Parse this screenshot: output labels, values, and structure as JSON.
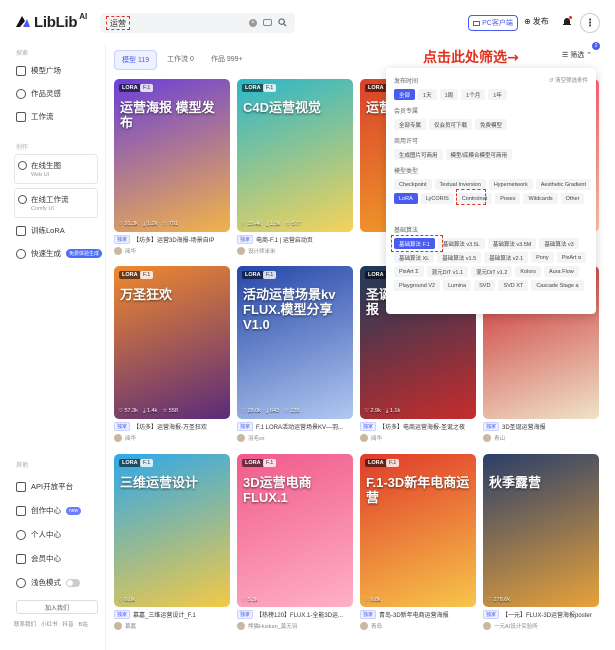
{
  "header": {
    "logo_text": "LibLib",
    "logo_sup": "AI",
    "search_value": "运营",
    "pc_client": "PC客户端",
    "publish": "发布"
  },
  "sidebar": {
    "section_explore": "探索",
    "explore_items": [
      {
        "label": "模型广场",
        "icon": "home-icon"
      },
      {
        "label": "作品灵感",
        "icon": "image-icon"
      },
      {
        "label": "工作流",
        "icon": "flow-icon"
      }
    ],
    "section_create": "创作",
    "create_boxes": [
      {
        "label": "在线生图",
        "sub": "Web UI"
      },
      {
        "label": "在线工作流",
        "sub": "Comfy UI"
      }
    ],
    "train": "训练LoRA",
    "quick": "快速生成",
    "quick_badge": "免费体验生成",
    "section_other": "其他",
    "other_items": [
      {
        "label": "API开放平台"
      },
      {
        "label": "创作中心",
        "badge": "new"
      },
      {
        "label": "个人中心"
      },
      {
        "label": "会员中心"
      },
      {
        "label": "浅色模式"
      }
    ],
    "join": "加入我们",
    "footer": [
      "联系我们",
      "小红书",
      "抖音",
      "B站"
    ]
  },
  "main": {
    "tabs": [
      {
        "label": "模型 119",
        "active": true
      },
      {
        "label": "工作流 0",
        "active": false
      },
      {
        "label": "作品 999+",
        "active": false
      }
    ],
    "annotation": "点击此处筛选→",
    "filter": "筛选",
    "filter_count": "2"
  },
  "filter_panel": {
    "reset": "清空筛选条件",
    "time_label": "发布时间",
    "time": [
      {
        "label": "全部",
        "on": true
      },
      {
        "label": "1天"
      },
      {
        "label": "1周"
      },
      {
        "label": "1个月"
      },
      {
        "label": "1年"
      }
    ],
    "member_label": "会员专属",
    "member": [
      {
        "label": "全部专属"
      },
      {
        "label": "仅会员可下载"
      },
      {
        "label": "免费模型"
      }
    ],
    "license_label": "商用许可",
    "license": [
      {
        "label": "生成图片可商用"
      },
      {
        "label": "模型/底模合模型可商用"
      }
    ],
    "type_label": "模型类型",
    "types": [
      {
        "label": "Checkpoint"
      },
      {
        "label": "Textual Inversion"
      },
      {
        "label": "Hypernetwork"
      },
      {
        "label": "Aesthetic Gradient"
      },
      {
        "label": "LoRA",
        "on": true
      },
      {
        "label": "LyCORIS"
      },
      {
        "label": "Controlnet"
      },
      {
        "label": "Poses"
      },
      {
        "label": "Wildcards"
      },
      {
        "label": "Other"
      }
    ],
    "base_label": "基础算法",
    "bases": [
      {
        "label": "基础算法 F.1",
        "on": true
      },
      {
        "label": "基础算法 v3.5L"
      },
      {
        "label": "基础算法 v3.5M"
      },
      {
        "label": "基础算法 v3"
      },
      {
        "label": "基础算法 XL"
      },
      {
        "label": "基础算法 v1.5"
      },
      {
        "label": "基础算法 v2.1"
      },
      {
        "label": "Pony"
      },
      {
        "label": "PixArt α"
      },
      {
        "label": "PixArt Σ"
      },
      {
        "label": "混元DiT v1.1"
      },
      {
        "label": "混元DiT v1.2"
      },
      {
        "label": "Kolors"
      },
      {
        "label": "Aura Flow"
      },
      {
        "label": "Playground V2"
      },
      {
        "label": "Lumina"
      },
      {
        "label": "SVD"
      },
      {
        "label": "SVD XT"
      },
      {
        "label": "Cascade Stage a"
      }
    ]
  },
  "cards": [
    {
      "tag": "LORA",
      "tag2": "F.1",
      "big": "运营海报 模型发布",
      "likes": "91.3k",
      "downloads": "1.2k",
      "stars": "791",
      "title": "【坊多】运营3D海报-场景自IP",
      "author": "阅华",
      "c1": "#6a3fd8",
      "c2": "#f2b34a"
    },
    {
      "tag": "LORA",
      "tag2": "F.1",
      "big": "C4D运营视觉",
      "likes": "19.4k",
      "downloads": "1.3k",
      "stars": "577",
      "title": "电商-F.1 | 运营启动页",
      "author": "设计师米米",
      "c1": "#2bb6c9",
      "c2": "#f5d35a"
    },
    {
      "tag": "LORA",
      "tag2": "F.1",
      "big": "运营 海报",
      "likes": "",
      "downloads": "",
      "stars": "",
      "title": "",
      "author": "",
      "c1": "#d8402b",
      "c2": "#f4a62a"
    },
    {
      "tag": "",
      "tag2": "",
      "big": "",
      "likes": "",
      "downloads": "",
      "stars": "",
      "title": "",
      "author": "",
      "c1": "#fd4c6a",
      "c2": "#ffc9a8"
    },
    {
      "tag": "LORA",
      "tag2": "F.1",
      "big": "万圣狂欢",
      "likes": "57.3k",
      "downloads": "1.4k",
      "stars": "558",
      "title": "【坊多】运营海报-万圣狂欢",
      "author": "阅华",
      "c1": "#f08a2e",
      "c2": "#5a2b7a"
    },
    {
      "tag": "LORA",
      "tag2": "F.1",
      "big": "活动运营场景kv FLUX.模型分享 V1.0",
      "likes": "28.0k",
      "downloads": "643",
      "stars": "235",
      "title": "F.1 LORA活动运营场景KV—羽...",
      "author": "羽毛xx",
      "c1": "#2646a8",
      "c2": "#b1c8f0"
    },
    {
      "tag": "LORA",
      "tag2": "F.1",
      "big": "圣诞之夜 运营 海报",
      "likes": "2.9k",
      "downloads": "1.1k",
      "stars": "",
      "title": "【坊多】电商运营海报-圣诞之夜",
      "author": "阅华",
      "c1": "#1b3a5a",
      "c2": "#c72c2c"
    },
    {
      "tag": "",
      "tag2": "",
      "big": "",
      "likes": "",
      "downloads": "",
      "stars": "",
      "title": "3D圣诞运营海报",
      "author": "青山",
      "c1": "#c8292e",
      "c2": "#f0e3c8"
    },
    {
      "tag": "LORA",
      "tag2": "F.1",
      "big": "三维运营设计",
      "likes": "6.0k",
      "downloads": "",
      "stars": "",
      "title": "慕嘉_三维运营设计_F.1",
      "author": "慕嘉",
      "c1": "#2fa8e8",
      "c2": "#f2c947"
    },
    {
      "tag": "LORA",
      "tag2": "F.1",
      "big": "3D运营电商 FLUX.1",
      "likes": "5.3k",
      "downloads": "",
      "stars": "",
      "title": "【热榜120】FLUX.1-全能3D运...",
      "author": "熊猫Huskan_莫无羽",
      "c1": "#f05a8a",
      "c2": "#ffb0c8"
    },
    {
      "tag": "LORA",
      "tag2": "F.1",
      "big": "F.1-3D新年电商运营",
      "likes": "6.8k",
      "downloads": "",
      "stars": "",
      "title": "青岛-3D新年电商运营海报",
      "author": "青岛",
      "c1": "#e03a2a",
      "c2": "#f7c54a"
    },
    {
      "tag": "",
      "tag2": "",
      "big": "秋季露营",
      "likes": "278.6k",
      "downloads": "",
      "stars": "",
      "title": "【一元】FLUX-3D运营海报poster",
      "author": "一元AI设计实验所",
      "c1": "#2a3f6a",
      "c2": "#e8a23a"
    }
  ]
}
